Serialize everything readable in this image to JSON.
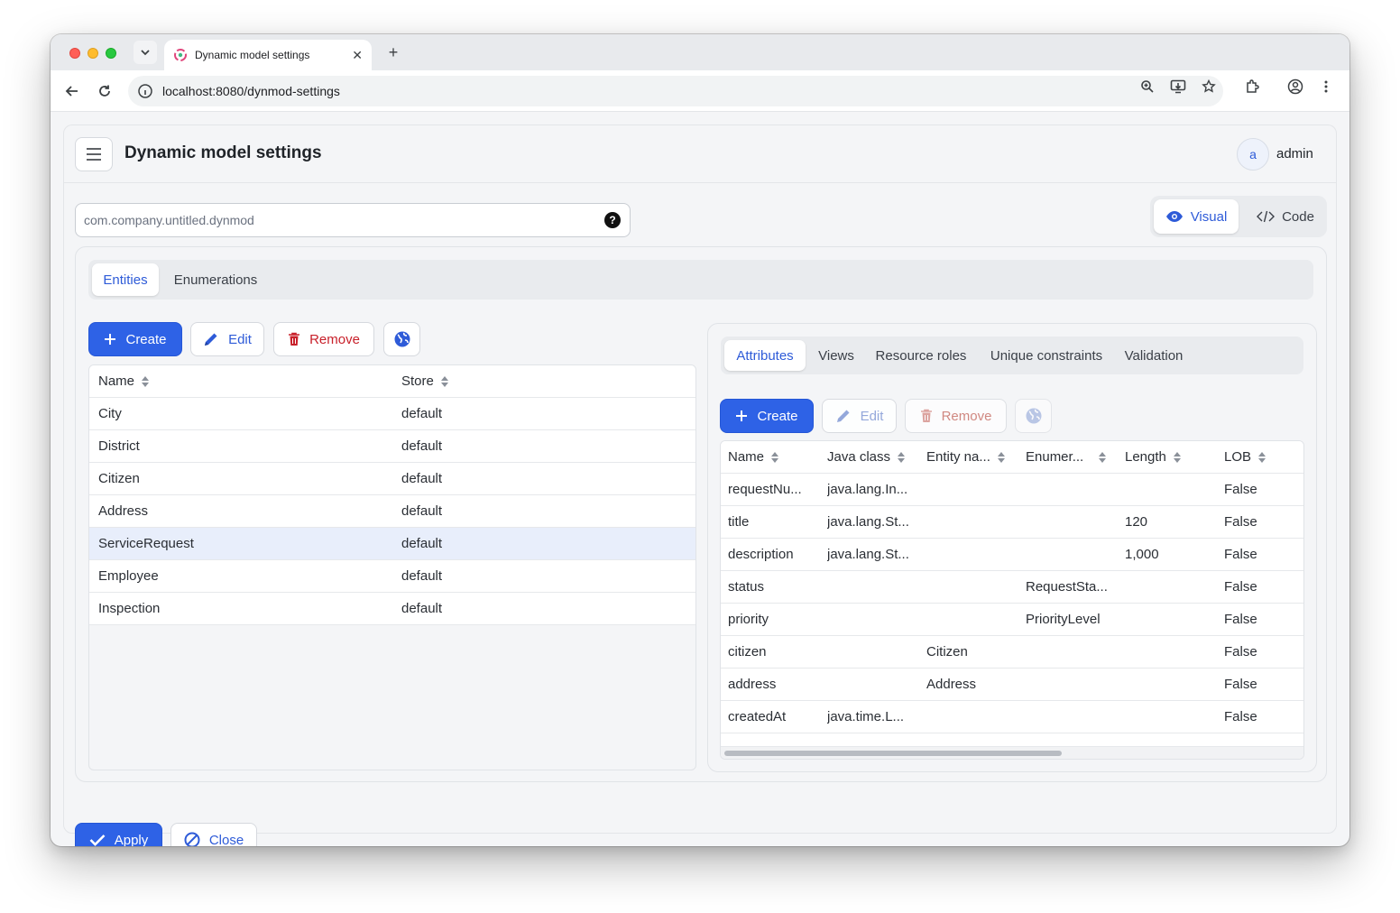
{
  "browser": {
    "tab_title": "Dynamic model settings",
    "tab_close": "✕",
    "new_tab": "+",
    "url": "localhost:8080/dynmod-settings"
  },
  "header": {
    "title": "Dynamic model settings",
    "avatar_initial": "a",
    "username": "admin"
  },
  "model": {
    "name_value": "com.company.untitled.dynmod",
    "help_symbol": "?"
  },
  "view_toggle": {
    "visual_label": "Visual",
    "code_label": "Code",
    "active": "Visual"
  },
  "main_tabs": [
    {
      "label": "Entities",
      "active": true
    },
    {
      "label": "Enumerations",
      "active": false
    }
  ],
  "entity_toolbar": {
    "create": "Create",
    "edit": "Edit",
    "remove": "Remove",
    "globe_icon": "globe-icon"
  },
  "entities": {
    "columns": [
      "Name",
      "Store"
    ],
    "rows": [
      {
        "name": "City",
        "store": "default"
      },
      {
        "name": "District",
        "store": "default"
      },
      {
        "name": "Citizen",
        "store": "default"
      },
      {
        "name": "Address",
        "store": "default"
      },
      {
        "name": "ServiceRequest",
        "store": "default",
        "selected": true
      },
      {
        "name": "Employee",
        "store": "default"
      },
      {
        "name": "Inspection",
        "store": "default"
      }
    ]
  },
  "detail_tabs": [
    {
      "label": "Attributes",
      "active": true
    },
    {
      "label": "Views",
      "active": false
    },
    {
      "label": "Resource roles",
      "active": false
    },
    {
      "label": "Unique constraints",
      "active": false
    },
    {
      "label": "Validation",
      "active": false
    }
  ],
  "attr_toolbar": {
    "create": "Create",
    "edit": "Edit",
    "remove": "Remove"
  },
  "attributes": {
    "columns": [
      "Name",
      "Java class",
      "Entity na...",
      "Enumer...",
      "Length",
      "LOB"
    ],
    "rows": [
      {
        "name": "requestNu...",
        "java": "java.lang.In...",
        "entity": "",
        "enum": "",
        "length": "",
        "lob": "False"
      },
      {
        "name": "title",
        "java": "java.lang.St...",
        "entity": "",
        "enum": "",
        "length": "120",
        "lob": "False"
      },
      {
        "name": "description",
        "java": "java.lang.St...",
        "entity": "",
        "enum": "",
        "length": "1,000",
        "lob": "False"
      },
      {
        "name": "status",
        "java": "",
        "entity": "",
        "enum": "RequestSta...",
        "length": "",
        "lob": "False"
      },
      {
        "name": "priority",
        "java": "",
        "entity": "",
        "enum": "PriorityLevel",
        "length": "",
        "lob": "False"
      },
      {
        "name": "citizen",
        "java": "",
        "entity": "Citizen",
        "enum": "",
        "length": "",
        "lob": "False"
      },
      {
        "name": "address",
        "java": "",
        "entity": "Address",
        "enum": "",
        "length": "",
        "lob": "False"
      },
      {
        "name": "createdAt",
        "java": "java.time.L...",
        "entity": "",
        "enum": "",
        "length": "",
        "lob": "False"
      }
    ]
  },
  "footer": {
    "apply": "Apply",
    "close": "Close"
  },
  "colors": {
    "primary": "#2e62e6",
    "link": "#2e5bd8",
    "danger": "#c8202a",
    "selected_row": "#e8eefb"
  }
}
